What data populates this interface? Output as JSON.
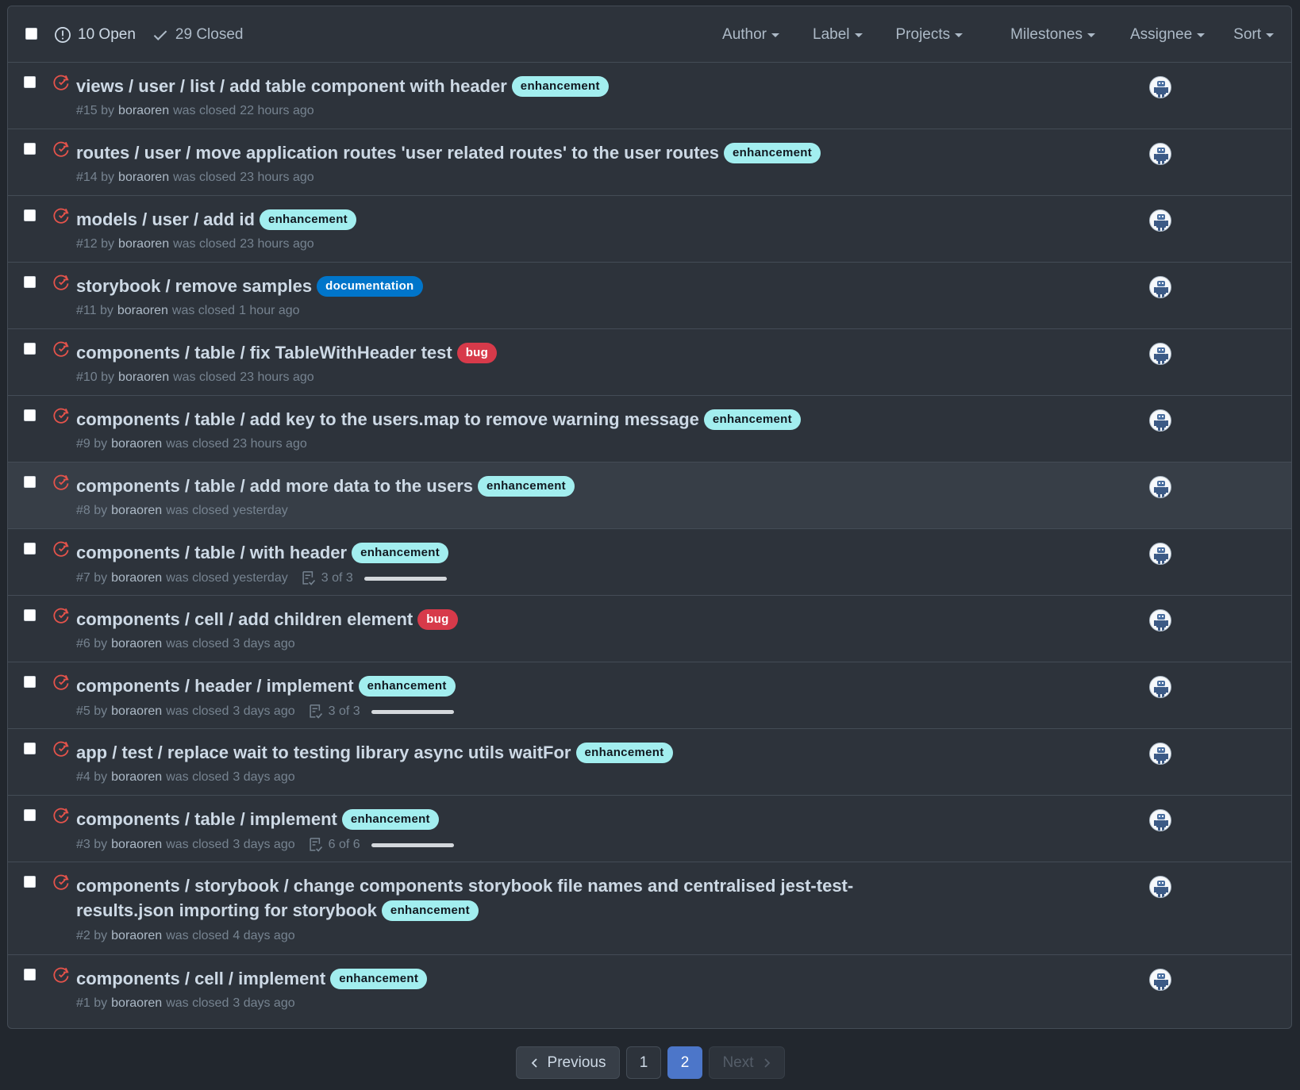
{
  "header": {
    "open_label": "10 Open",
    "closed_label": "29 Closed",
    "filters": [
      "Author",
      "Label",
      "Projects",
      "Milestones",
      "Assignee",
      "Sort"
    ]
  },
  "colors": {
    "closed_icon": "#e5534b",
    "label_enhancement": "#a2eeef",
    "label_documentation": "#0075ca",
    "label_bug": "#d73a4a",
    "page_current": "#4c76c9"
  },
  "issues": [
    {
      "title": "views / user / list / add table component with header",
      "label": "enhancement",
      "number": "#15",
      "author": "boraoren",
      "status": "was closed",
      "time": "22 hours ago"
    },
    {
      "title": "routes / user / move application routes 'user related routes' to the user routes",
      "label": "enhancement",
      "number": "#14",
      "author": "boraoren",
      "status": "was closed",
      "time": "23 hours ago"
    },
    {
      "title": "models / user / add id",
      "label": "enhancement",
      "number": "#12",
      "author": "boraoren",
      "status": "was closed",
      "time": "23 hours ago"
    },
    {
      "title": "storybook / remove samples",
      "label": "documentation",
      "number": "#11",
      "author": "boraoren",
      "status": "was closed",
      "time": "1 hour ago"
    },
    {
      "title": "components / table / fix TableWithHeader test",
      "label": "bug",
      "number": "#10",
      "author": "boraoren",
      "status": "was closed",
      "time": "23 hours ago"
    },
    {
      "title": "components / table / add key to the users.map to remove warning message",
      "label": "enhancement",
      "number": "#9",
      "author": "boraoren",
      "status": "was closed",
      "time": "23 hours ago"
    },
    {
      "title": "components / table / add more data to the users",
      "label": "enhancement",
      "number": "#8",
      "author": "boraoren",
      "status": "was closed",
      "time": "yesterday"
    },
    {
      "title": "components / table / with header",
      "label": "enhancement",
      "number": "#7",
      "author": "boraoren",
      "status": "was closed",
      "time": "yesterday",
      "tasks": "3 of 3",
      "task_progress": 1.0
    },
    {
      "title": "components / cell / add children element",
      "label": "bug",
      "number": "#6",
      "author": "boraoren",
      "status": "was closed",
      "time": "3 days ago"
    },
    {
      "title": "components / header / implement",
      "label": "enhancement",
      "number": "#5",
      "author": "boraoren",
      "status": "was closed",
      "time": "3 days ago",
      "tasks": "3 of 3",
      "task_progress": 1.0
    },
    {
      "title": "app / test / replace wait to testing library async utils waitFor",
      "label": "enhancement",
      "number": "#4",
      "author": "boraoren",
      "status": "was closed",
      "time": "3 days ago"
    },
    {
      "title": "components / table / implement",
      "label": "enhancement",
      "number": "#3",
      "author": "boraoren",
      "status": "was closed",
      "time": "3 days ago",
      "tasks": "6 of 6",
      "task_progress": 1.0
    },
    {
      "title": "components / storybook / change components storybook file names and centralised jest-test-results.json importing for storybook",
      "label": "enhancement",
      "number": "#2",
      "author": "boraoren",
      "status": "was closed",
      "time": "4 days ago"
    },
    {
      "title": "components / cell / implement",
      "label": "enhancement",
      "number": "#1",
      "author": "boraoren",
      "status": "was closed",
      "time": "3 days ago"
    }
  ],
  "pagination": {
    "previous": "Previous",
    "pages": [
      "1",
      "2"
    ],
    "current": "2",
    "next": "Next"
  }
}
